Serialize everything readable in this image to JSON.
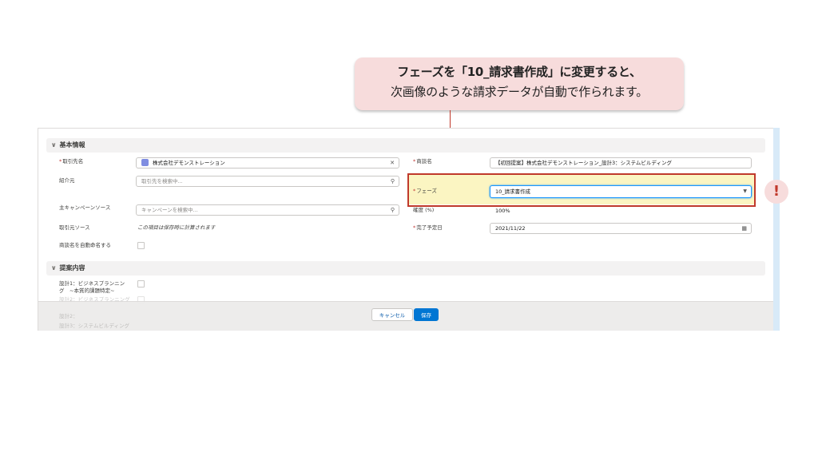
{
  "callout": {
    "line1": "フェーズを「10_請求書作成」に変更すると、",
    "line2": "次画像のような請求データが自動で作られます。"
  },
  "section_basic": {
    "title": "基本情報"
  },
  "section_proposal": {
    "title": "提案内容"
  },
  "fields": {
    "account_label": "取引先名",
    "account_value": "株式会社デモンストレーション",
    "referrer_label": "紹介元",
    "referrer_placeholder": "取引先を検索中...",
    "campaign_label": "主キャンペーンソース",
    "campaign_placeholder": "キャンペーンを検索中...",
    "lead_source_label": "取引元ソース",
    "lead_source_note": "この項目は保存時に計算されます",
    "auto_name_label": "商談名を自動命名する",
    "opp_name_label": "商談名",
    "opp_name_value": "【初回提案】株式会社デモンストレーション_設計3：システムビルディング",
    "phase_label": "フェーズ",
    "phase_value": "10_請求書作成",
    "probability_label": "確度 (%)",
    "probability_value": "100%",
    "close_date_label": "完了予定日",
    "close_date_value": "2021/11/22",
    "design1_label_line1": "設計1：ビジネスプランニン",
    "design1_label_line2": "グ　~本質的課題特定~",
    "design2_label_partial": "設計2：ビジネスプランニング",
    "design2_label_partial2": "設計2：",
    "design3_label_partial": "設計3：システムビルディング"
  },
  "required_mark": "*",
  "footer": {
    "cancel_label": "キャンセル",
    "save_label": "保存"
  },
  "alert_mark": "!",
  "colors": {
    "accent": "#0176d3",
    "highlight_red": "#c0392b",
    "callout_bg": "#f7dcdc",
    "phase_bg": "#fbf5c2"
  }
}
